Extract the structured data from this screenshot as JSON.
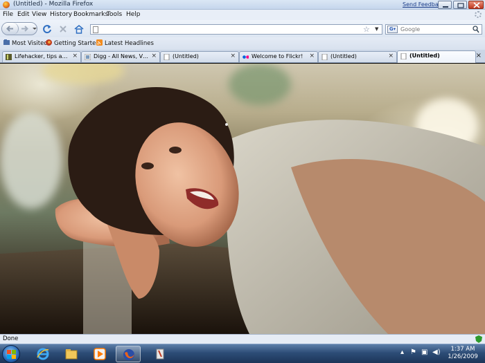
{
  "window": {
    "title": "(Untitled) - Mozilla Firefox",
    "feedback_link": "Send Feedback"
  },
  "menu": [
    "File",
    "Edit",
    "View",
    "History",
    "Bookmarks",
    "Tools",
    "Help"
  ],
  "navigation": {
    "url_value": "",
    "search_placeholder": "Google"
  },
  "bookmarks": [
    {
      "label": "Most Visited",
      "icon": "bookmarks-folder-icon"
    },
    {
      "label": "Getting Started",
      "icon": "firefox-icon"
    },
    {
      "label": "Latest Headlines",
      "icon": "rss-feed-icon"
    }
  ],
  "tabs": [
    {
      "label": "Lifehacker, tips and ...",
      "icon": "lifehacker-icon",
      "active": false
    },
    {
      "label": "Digg - All News, Vid...",
      "icon": "digg-icon",
      "active": false
    },
    {
      "label": "(Untitled)",
      "icon": "page-icon",
      "active": false
    },
    {
      "label": "Welcome to Flickr!",
      "icon": "flickr-icon",
      "active": false
    },
    {
      "label": "(Untitled)",
      "icon": "page-icon",
      "active": false
    },
    {
      "label": "(Untitled)",
      "icon": "page-icon",
      "active": true
    }
  ],
  "status": {
    "text": "Done"
  },
  "taskbar": {
    "apps": [
      "internet-explorer-icon",
      "windows-explorer-icon",
      "media-player-icon",
      "firefox-icon",
      "paint-tool-icon"
    ],
    "clock_time": "1:37 AM",
    "clock_date": "1/26/2009"
  },
  "colors": {
    "chrome_bg": "#dde6f2",
    "taskbar_bg": "#2d4d77",
    "link": "#1e3f8a"
  }
}
